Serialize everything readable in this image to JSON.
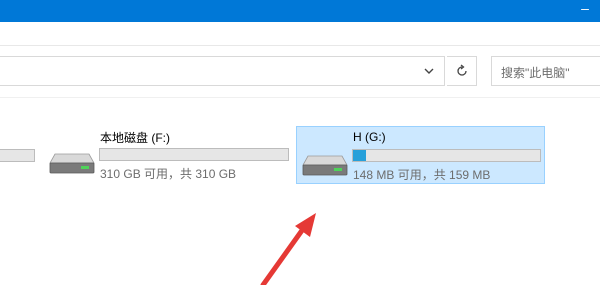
{
  "window": {
    "minimize_glyph": "–"
  },
  "toolbar": {
    "search_placeholder": "搜索\"此电脑\"",
    "dropdown_icon": "chevron-down-icon",
    "refresh_icon": "refresh-icon"
  },
  "drives": [
    {
      "name": "本地磁盘 (F:)",
      "space": "310 GB 可用，共 310 GB",
      "used_fraction": 0.0,
      "selected": false
    },
    {
      "name": "H (G:)",
      "space": "148 MB 可用，共 159 MB",
      "used_fraction": 0.07,
      "selected": true
    }
  ],
  "colors": {
    "titlebar": "#0078d7",
    "selection_bg": "#cce8ff",
    "selection_border": "#99d1ff",
    "usage_fill": "#26a0da",
    "annotation_arrow": "#e53935"
  }
}
